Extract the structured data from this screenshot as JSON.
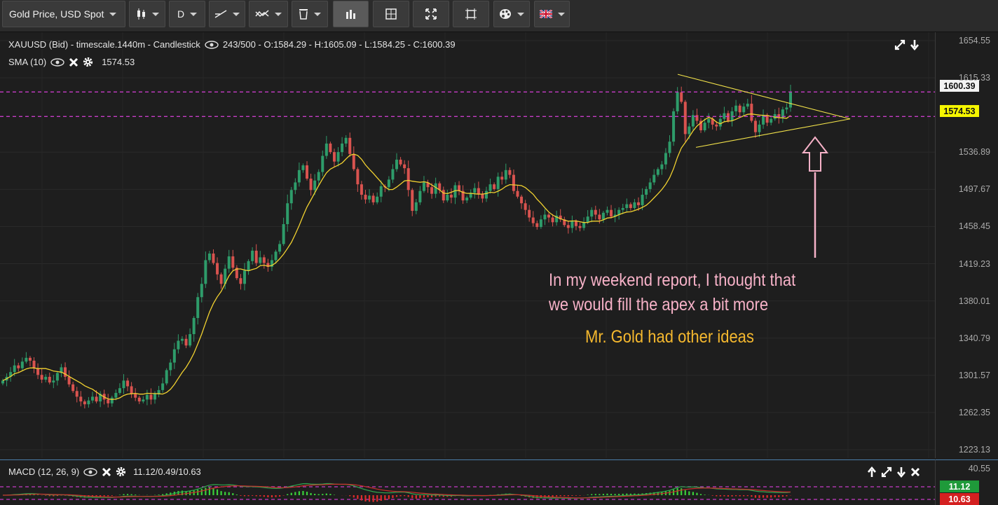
{
  "toolbar": {
    "instrument": "Gold Price, USD Spot",
    "timeframe": "D"
  },
  "chart": {
    "header": {
      "symbol_line": "XAUUSD (Bid) - timescale.1440m - Candlestick",
      "ohlc_line": "243/500 - O:1584.29 - H:1605.09 - L:1584.25 - C:1600.39"
    },
    "sma": {
      "label": "SMA (10)",
      "value": "1574.53"
    },
    "price_axis": [
      "1654.55",
      "1615.33",
      "1536.89",
      "1497.67",
      "1458.45",
      "1419.23",
      "1380.01",
      "1340.79",
      "1301.57",
      "1262.35",
      "1223.13"
    ],
    "tags": {
      "close": "1600.39",
      "sma": "1574.53"
    },
    "colors": {
      "up": "#2e9c6a",
      "down": "#d9534f",
      "sma": "#f2d230",
      "level": "#c63cc6",
      "annotation_pink": "#f7b2c8",
      "annotation_gold": "#f5b82e"
    },
    "annotations": {
      "line1": "In my weekend report, I thought that",
      "line2": "we would fill the apex a bit more",
      "line3": "Mr. Gold had other ideas"
    }
  },
  "macd": {
    "label": "MACD (12, 26, 9)",
    "values": "11.12/0.49/10.63",
    "axis_top": "40.55",
    "tag_macd": "11.12",
    "tag_signal": "10.63"
  },
  "chart_data": {
    "type": "candlestick",
    "ylim": [
      1223.13,
      1654.55
    ],
    "closes": [
      1296,
      1300,
      1305,
      1312,
      1309,
      1316,
      1320,
      1317,
      1309,
      1302,
      1297,
      1300,
      1294,
      1296,
      1304,
      1310,
      1300,
      1292,
      1285,
      1279,
      1274,
      1271,
      1275,
      1279,
      1274,
      1282,
      1276,
      1272,
      1278,
      1283,
      1288,
      1296,
      1290,
      1282,
      1278,
      1274,
      1276,
      1281,
      1276,
      1282,
      1286,
      1293,
      1307,
      1315,
      1329,
      1338,
      1340,
      1333,
      1345,
      1362,
      1384,
      1398,
      1423,
      1430,
      1420,
      1408,
      1398,
      1414,
      1427,
      1415,
      1404,
      1398,
      1412,
      1422,
      1433,
      1420,
      1426,
      1420,
      1416,
      1423,
      1432,
      1440,
      1461,
      1483,
      1497,
      1505,
      1518,
      1523,
      1509,
      1497,
      1507,
      1516,
      1533,
      1546,
      1537,
      1527,
      1537,
      1546,
      1552,
      1535,
      1519,
      1503,
      1492,
      1487,
      1491,
      1484,
      1490,
      1501,
      1500,
      1508,
      1519,
      1529,
      1524,
      1520,
      1497,
      1475,
      1484,
      1496,
      1505,
      1500,
      1493,
      1504,
      1497,
      1486,
      1492,
      1489,
      1502,
      1496,
      1486,
      1489,
      1494,
      1499,
      1493,
      1488,
      1496,
      1503,
      1498,
      1511,
      1508,
      1518,
      1513,
      1496,
      1490,
      1483,
      1476,
      1468,
      1462,
      1458,
      1466,
      1471,
      1468,
      1463,
      1470,
      1466,
      1460,
      1457,
      1464,
      1459,
      1457,
      1463,
      1469,
      1476,
      1471,
      1466,
      1473,
      1476,
      1469,
      1471,
      1476,
      1478,
      1482,
      1478,
      1484,
      1481,
      1492,
      1498,
      1505,
      1513,
      1519,
      1524,
      1536,
      1548,
      1580,
      1600,
      1590,
      1556,
      1564,
      1576,
      1570,
      1560,
      1568,
      1572,
      1566,
      1564,
      1572,
      1578,
      1570,
      1580,
      1586,
      1579,
      1585,
      1588,
      1570,
      1558,
      1566,
      1576,
      1568,
      1572,
      1577,
      1573,
      1582,
      1584,
      1600
    ]
  }
}
